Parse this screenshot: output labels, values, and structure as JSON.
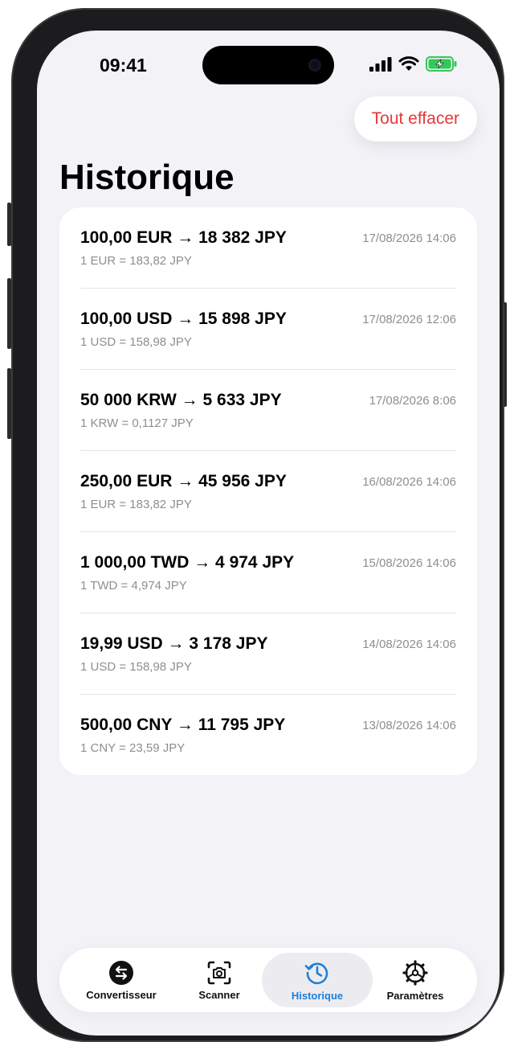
{
  "status_bar": {
    "time": "09:41"
  },
  "header": {
    "clear_label": "Tout effacer",
    "title": "Historique"
  },
  "history": [
    {
      "main": "100,00 EUR → 18 382 JPY",
      "rate": "1 EUR = 183,82 JPY",
      "date": "17/08/2026 14:06"
    },
    {
      "main": "100,00 USD → 15 898 JPY",
      "rate": "1 USD = 158,98 JPY",
      "date": "17/08/2026 12:06"
    },
    {
      "main": "50 000 KRW → 5 633 JPY",
      "rate": "1 KRW = 0,1127 JPY",
      "date": "17/08/2026 8:06"
    },
    {
      "main": "250,00 EUR → 45 956 JPY",
      "rate": "1 EUR = 183,82 JPY",
      "date": "16/08/2026 14:06"
    },
    {
      "main": "1 000,00 TWD → 4 974 JPY",
      "rate": "1 TWD = 4,974 JPY",
      "date": "15/08/2026 14:06"
    },
    {
      "main": "19,99 USD → 3 178 JPY",
      "rate": "1 USD = 158,98 JPY",
      "date": "14/08/2026 14:06"
    },
    {
      "main": "500,00 CNY → 11 795 JPY",
      "rate": "1 CNY = 23,59 JPY",
      "date": "13/08/2026 14:06"
    }
  ],
  "tabs": [
    {
      "label": "Convertisseur",
      "icon": "convert-icon"
    },
    {
      "label": "Scanner",
      "icon": "camera-scan-icon"
    },
    {
      "label": "Historique",
      "icon": "history-icon",
      "active": true
    },
    {
      "label": "Paramètres",
      "icon": "gear-icon"
    }
  ],
  "colors": {
    "accent": "#1e7fd8",
    "destructive": "#e5393b",
    "background": "#f2f2f7"
  }
}
